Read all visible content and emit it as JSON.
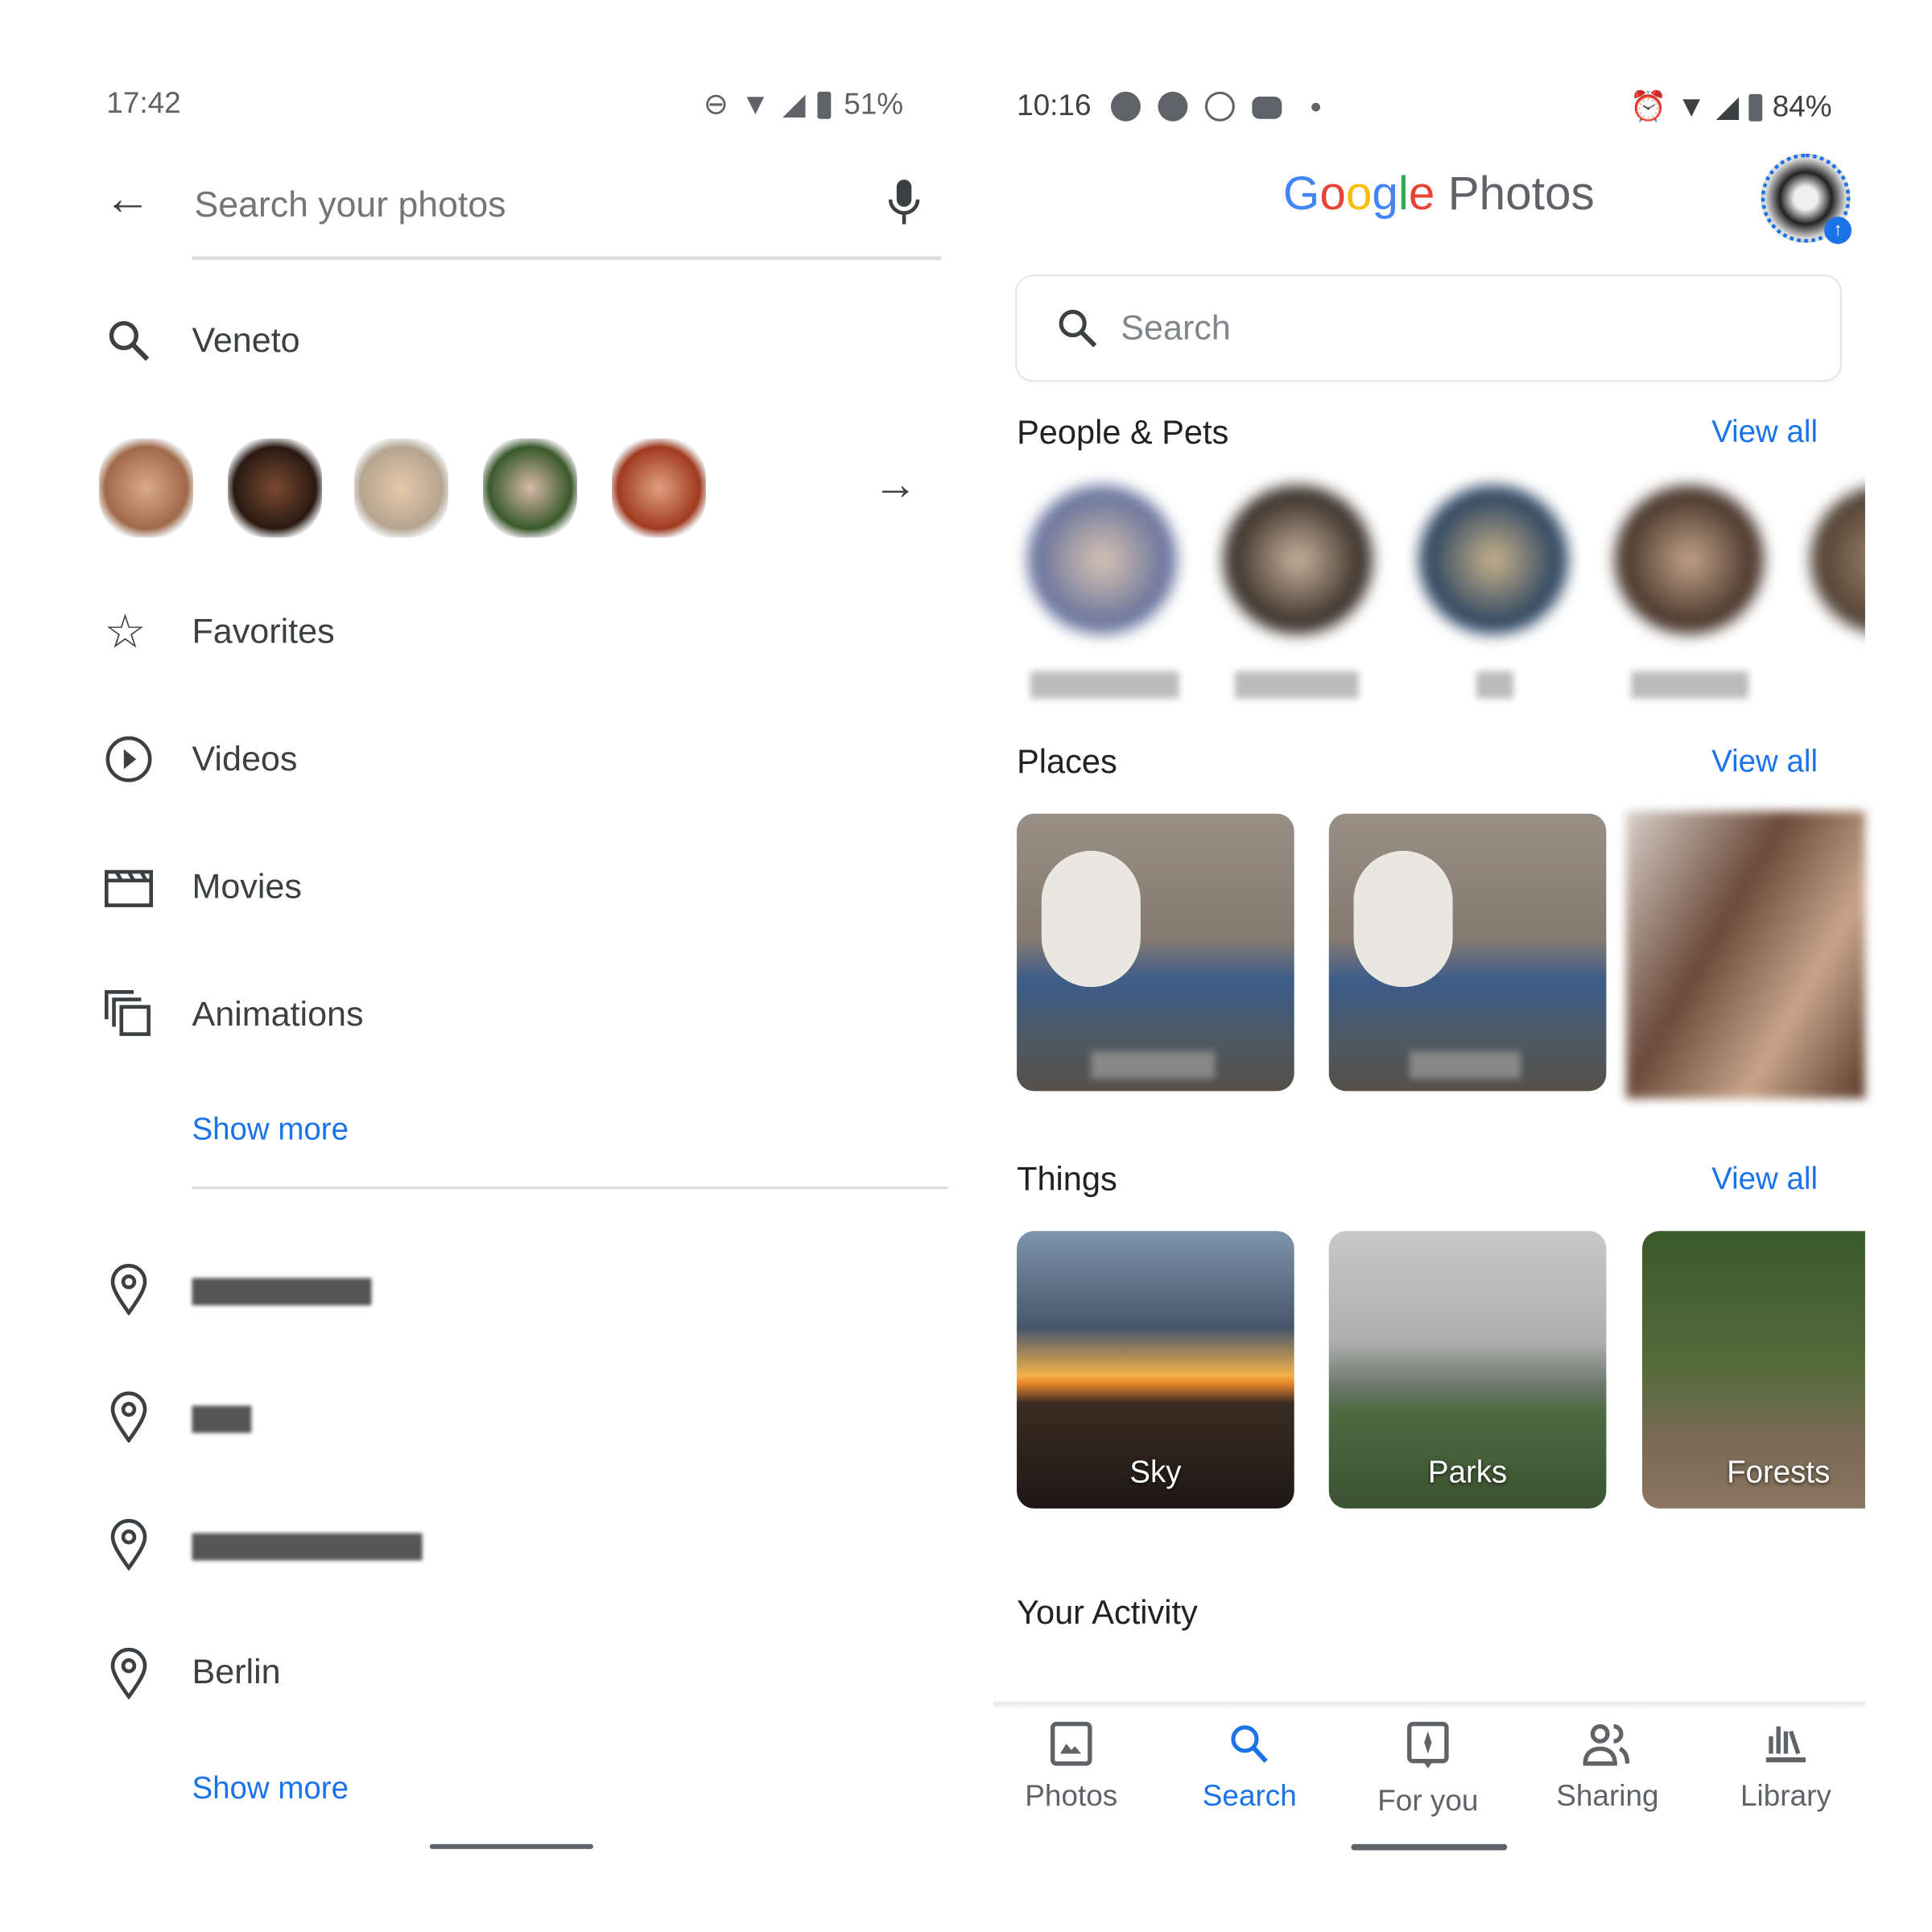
{
  "left": {
    "status": {
      "time": "17:42",
      "battery": "51%",
      "icons": [
        "dnd-icon",
        "wifi-icon",
        "signal-icon",
        "battery-icon"
      ]
    },
    "search": {
      "placeholder": "Search your photos",
      "back_icon": "arrow-left-icon",
      "mic_icon": "mic-icon"
    },
    "recent": [
      {
        "icon": "search-icon",
        "label": "Veneto"
      }
    ],
    "people_arrow_icon": "arrow-right-icon",
    "categories": [
      {
        "icon": "star-icon",
        "label": "Favorites"
      },
      {
        "icon": "play-circle-icon",
        "label": "Videos"
      },
      {
        "icon": "movie-icon",
        "label": "Movies"
      },
      {
        "icon": "animation-icon",
        "label": "Animations"
      }
    ],
    "show_more_1": "Show more",
    "places": [
      {
        "icon": "pin-icon",
        "label": ""
      },
      {
        "icon": "pin-icon",
        "label": ""
      },
      {
        "icon": "pin-icon",
        "label": ""
      },
      {
        "icon": "pin-icon",
        "label": "Berlin"
      }
    ],
    "show_more_2": "Show more"
  },
  "right": {
    "status": {
      "time": "10:16",
      "battery": "84%",
      "icons": [
        "telegram-icon",
        "telegram-icon",
        "whatsapp-icon",
        "discord-icon",
        "dot-icon",
        "alarm-icon",
        "wifi-icon",
        "signal-icon",
        "battery-icon"
      ]
    },
    "app_title": {
      "google": "Google",
      "photos": "Photos"
    },
    "search_placeholder": "Search",
    "sections": {
      "people": {
        "title": "People & Pets",
        "view_all": "View all"
      },
      "places": {
        "title": "Places",
        "view_all": "View all"
      },
      "things": {
        "title": "Things",
        "view_all": "View all",
        "tiles": [
          "Sky",
          "Parks",
          "Forests"
        ]
      },
      "activity": {
        "title": "Your Activity"
      }
    },
    "nav": [
      {
        "label": "Photos",
        "icon": "photo-icon",
        "active": false
      },
      {
        "label": "Search",
        "icon": "search-icon",
        "active": true
      },
      {
        "label": "For you",
        "icon": "for-you-icon",
        "active": false
      },
      {
        "label": "Sharing",
        "icon": "sharing-icon",
        "active": false
      },
      {
        "label": "Library",
        "icon": "library-icon",
        "active": false
      }
    ],
    "colors": {
      "accent": "#1a73e8",
      "text": "#3c4043",
      "muted": "#5f6368"
    }
  }
}
